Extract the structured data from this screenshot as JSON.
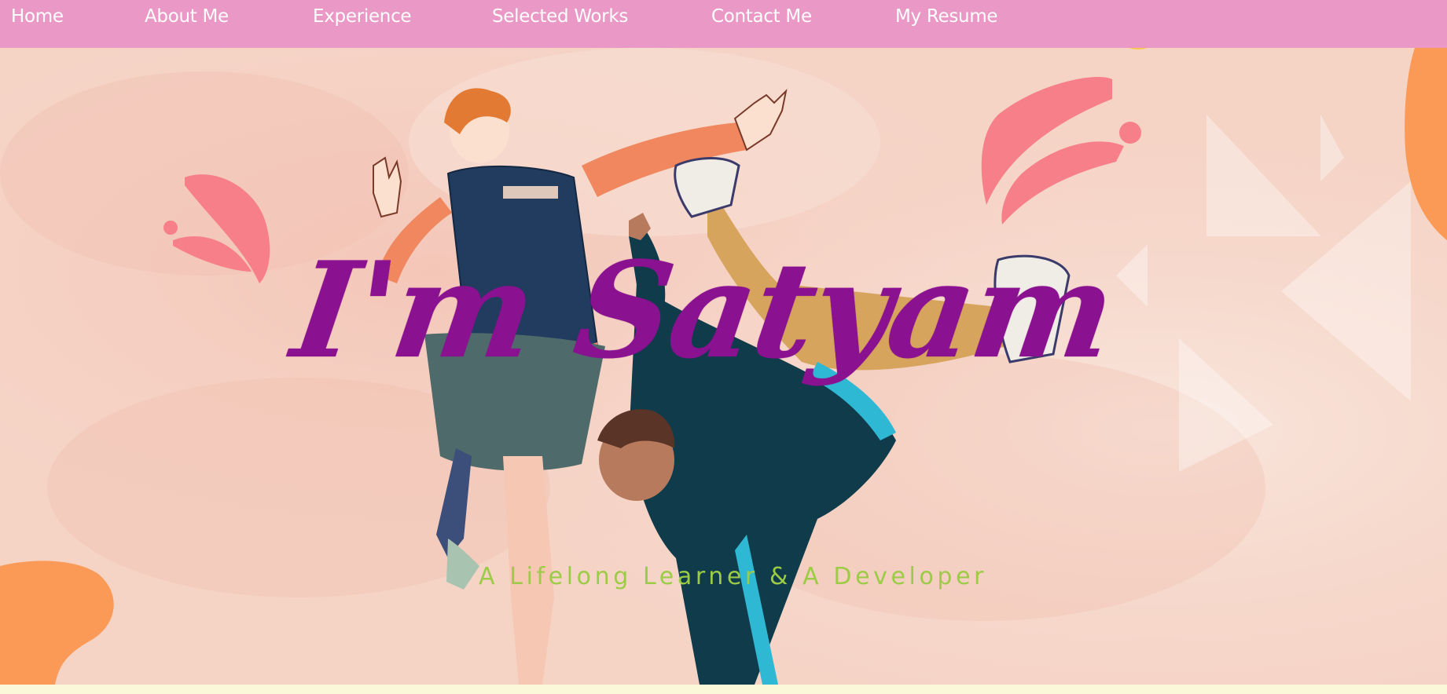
{
  "nav": {
    "items": [
      {
        "label": "Home"
      },
      {
        "label": "About Me"
      },
      {
        "label": "Experience"
      },
      {
        "label": "Selected Works"
      },
      {
        "label": "Contact Me"
      },
      {
        "label": "My Resume"
      }
    ]
  },
  "hero": {
    "title": "I'm Satyam",
    "subtitle": "A Lifelong Learner & A Developer"
  },
  "colors": {
    "nav_background": "#ea98c5",
    "title": "#8a118f",
    "subtitle": "#9ccb46",
    "accent_orange": "#fb9a56",
    "accent_pink": "#f77f8a"
  }
}
